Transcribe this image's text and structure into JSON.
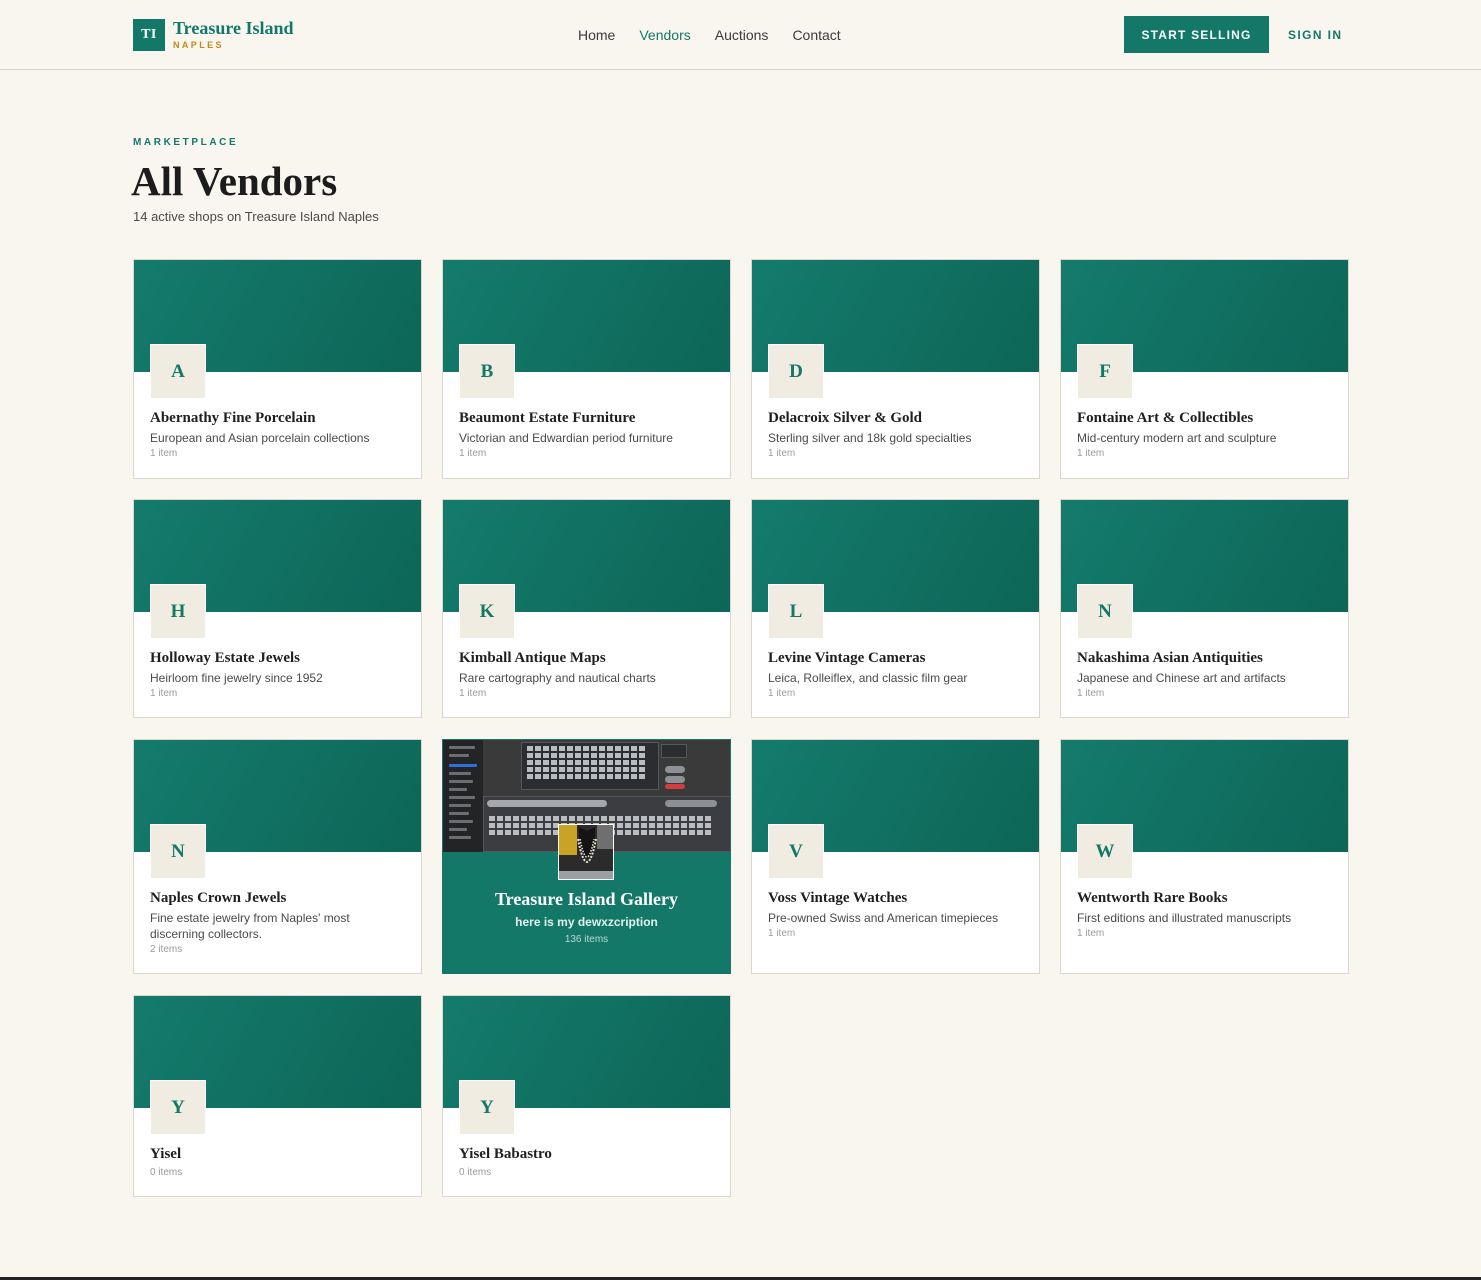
{
  "brand": {
    "mark": "TI",
    "name": "Treasure Island",
    "location": "NAPLES"
  },
  "nav": {
    "items": [
      "Home",
      "Vendors",
      "Auctions",
      "Contact"
    ],
    "active": "Vendors"
  },
  "header_actions": {
    "start_selling": "START SELLING",
    "sign_in": "SIGN IN"
  },
  "page": {
    "eyebrow": "MARKETPLACE",
    "title": "All Vendors",
    "subtitle": "14 active shops on Treasure Island Naples"
  },
  "vendors": [
    {
      "initial": "A",
      "name": "Abernathy Fine Porcelain",
      "description": "European and Asian porcelain collections",
      "count": "1 item"
    },
    {
      "initial": "B",
      "name": "Beaumont Estate Furniture",
      "description": "Victorian and Edwardian period furniture",
      "count": "1 item"
    },
    {
      "initial": "D",
      "name": "Delacroix Silver & Gold",
      "description": "Sterling silver and 18k gold specialties",
      "count": "1 item"
    },
    {
      "initial": "F",
      "name": "Fontaine Art & Collectibles",
      "description": "Mid-century modern art and sculpture",
      "count": "1 item"
    },
    {
      "initial": "H",
      "name": "Holloway Estate Jewels",
      "description": "Heirloom fine jewelry since 1952",
      "count": "1 item"
    },
    {
      "initial": "K",
      "name": "Kimball Antique Maps",
      "description": "Rare cartography and nautical charts",
      "count": "1 item"
    },
    {
      "initial": "L",
      "name": "Levine Vintage Cameras",
      "description": "Leica, Rolleiflex, and classic film gear",
      "count": "1 item"
    },
    {
      "initial": "N",
      "name": "Nakashima Asian Antiquities",
      "description": "Japanese and Chinese art and artifacts",
      "count": "1 item"
    },
    {
      "initial": "N",
      "name": "Naples Crown Jewels",
      "description": "Fine estate jewelry from Naples' most discerning collectors.",
      "count": "2 items"
    },
    {
      "featured": true,
      "name": "Treasure Island Gallery",
      "description": "here is my dewxzcription",
      "count": "136 items"
    },
    {
      "initial": "V",
      "name": "Voss Vintage Watches",
      "description": "Pre-owned Swiss and American timepieces",
      "count": "1 item"
    },
    {
      "initial": "W",
      "name": "Wentworth Rare Books",
      "description": "First editions and illustrated manuscripts",
      "count": "1 item"
    },
    {
      "initial": "Y",
      "name": "Yisel",
      "description": "",
      "count": "0 items"
    },
    {
      "initial": "Y",
      "name": "Yisel Babastro",
      "description": "",
      "count": "0 items"
    }
  ],
  "colors": {
    "brand": "#137868",
    "accent": "#c28a1e",
    "background": "#f9f6ef",
    "badge": "#f1ece1"
  }
}
